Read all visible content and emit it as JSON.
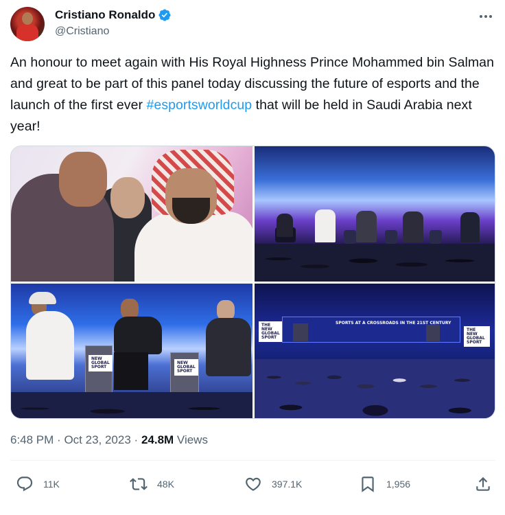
{
  "author": {
    "display_name": "Cristiano Ronaldo",
    "handle": "@Cristiano"
  },
  "tweet": {
    "text_before": "An honour to meet again with His Royal Highness Prince Mohammed bin Salman and great to be part of this panel today discussing the future of esports and the launch of the first ever ",
    "hashtag": "#esportsworldcup",
    "text_after": " that will be held in Saudi Arabia next year!"
  },
  "media": {
    "photo4_screen_title": "SPORTS AT A CROSSROADS IN THE 21ST CENTURY",
    "photo4_logo": "THE NEW GLOBAL SPORT"
  },
  "meta": {
    "time": "6:48 PM",
    "separator": "·",
    "date": "Oct 23, 2023",
    "views_count": "24.8M",
    "views_label": "Views"
  },
  "actions": {
    "replies": "11K",
    "reposts": "48K",
    "likes": "397.1K",
    "bookmarks": "1,956"
  },
  "colors": {
    "accent": "#1d9bf0",
    "text": "#0f1419",
    "secondary": "#536471"
  }
}
